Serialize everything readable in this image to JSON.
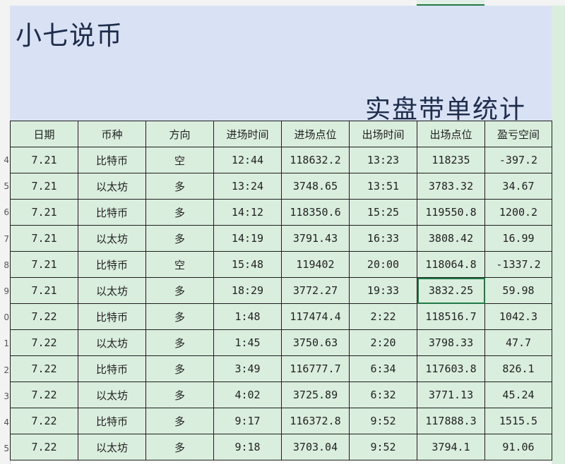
{
  "banner": {
    "brand": "小七说币",
    "subtitle": "实盘带单统计"
  },
  "row_numbers": [
    "4",
    "5",
    "6",
    "7",
    "8",
    "9",
    "0",
    "1",
    "2",
    "3",
    "4",
    "5"
  ],
  "table": {
    "headers": [
      "日期",
      "币种",
      "方向",
      "进场时间",
      "进场点位",
      "出场时间",
      "出场点位",
      "盈亏空间"
    ],
    "rows": [
      [
        "7.21",
        "比特币",
        "空",
        "12:44",
        "118632.2",
        "13:23",
        "118235",
        "-397.2"
      ],
      [
        "7.21",
        "以太坊",
        "多",
        "13:24",
        "3748.65",
        "13:51",
        "3783.32",
        "34.67"
      ],
      [
        "7.21",
        "比特币",
        "多",
        "14:12",
        "118350.6",
        "15:25",
        "119550.8",
        "1200.2"
      ],
      [
        "7.21",
        "以太坊",
        "多",
        "14:19",
        "3791.43",
        "16:33",
        "3808.42",
        "16.99"
      ],
      [
        "7.21",
        "比特币",
        "空",
        "15:48",
        "119402",
        "20:00",
        "118064.8",
        "-1337.2"
      ],
      [
        "7.21",
        "以太坊",
        "多",
        "18:29",
        "3772.27",
        "19:33",
        "3832.25",
        "59.98"
      ],
      [
        "7.22",
        "比特币",
        "多",
        "1:48",
        "117474.4",
        "2:22",
        "118516.7",
        "1042.3"
      ],
      [
        "7.22",
        "以太坊",
        "多",
        "1:45",
        "3750.63",
        "2:20",
        "3798.33",
        "47.7"
      ],
      [
        "7.22",
        "比特币",
        "多",
        "3:49",
        "116777.7",
        "6:34",
        "117603.8",
        "826.1"
      ],
      [
        "7.22",
        "以太坊",
        "多",
        "4:02",
        "3725.89",
        "6:32",
        "3771.13",
        "45.24"
      ],
      [
        "7.22",
        "比特币",
        "多",
        "9:17",
        "116372.8",
        "9:52",
        "117888.3",
        "1515.5"
      ],
      [
        "7.22",
        "以太坊",
        "多",
        "9:18",
        "3703.04",
        "9:52",
        "3794.1",
        "91.06"
      ]
    ]
  }
}
